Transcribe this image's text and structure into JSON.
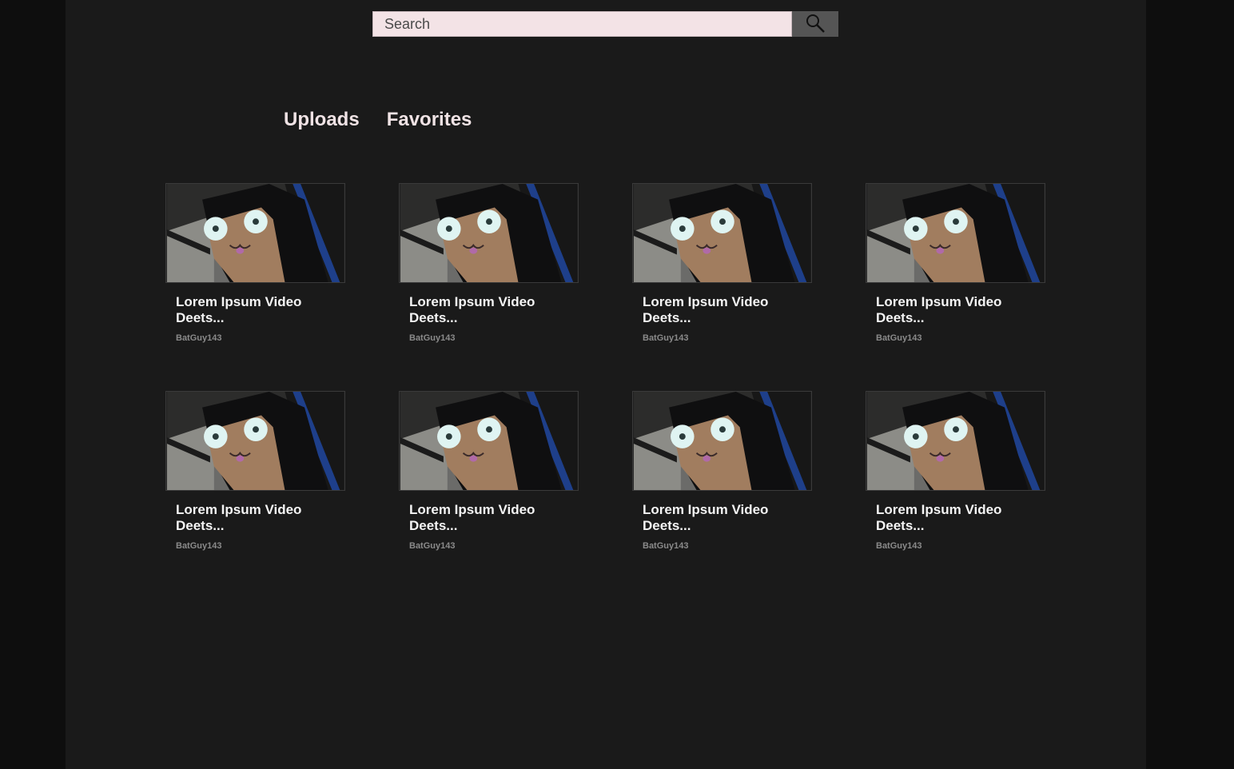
{
  "search": {
    "placeholder": "Search",
    "icon": "search-icon"
  },
  "tabs": [
    {
      "label": "Uploads"
    },
    {
      "label": "Favorites"
    }
  ],
  "videos": [
    {
      "title": "Lorem Ipsum Video Deets...",
      "author": "BatGuy143"
    },
    {
      "title": "Lorem Ipsum Video Deets...",
      "author": "BatGuy143"
    },
    {
      "title": "Lorem Ipsum Video Deets...",
      "author": "BatGuy143"
    },
    {
      "title": "Lorem Ipsum Video Deets...",
      "author": "BatGuy143"
    },
    {
      "title": "Lorem Ipsum Video Deets...",
      "author": "BatGuy143"
    },
    {
      "title": "Lorem Ipsum Video Deets...",
      "author": "BatGuy143"
    },
    {
      "title": "Lorem Ipsum Video Deets...",
      "author": "BatGuy143"
    },
    {
      "title": "Lorem Ipsum Video Deets...",
      "author": "BatGuy143"
    }
  ],
  "colors": {
    "background": "#1a1a1a",
    "outer_background": "#0e0e0e",
    "search_field": "#f3e3e6",
    "search_button": "#555555",
    "tab_text": "#f0e3e5",
    "author_text": "#8a8a8a"
  }
}
